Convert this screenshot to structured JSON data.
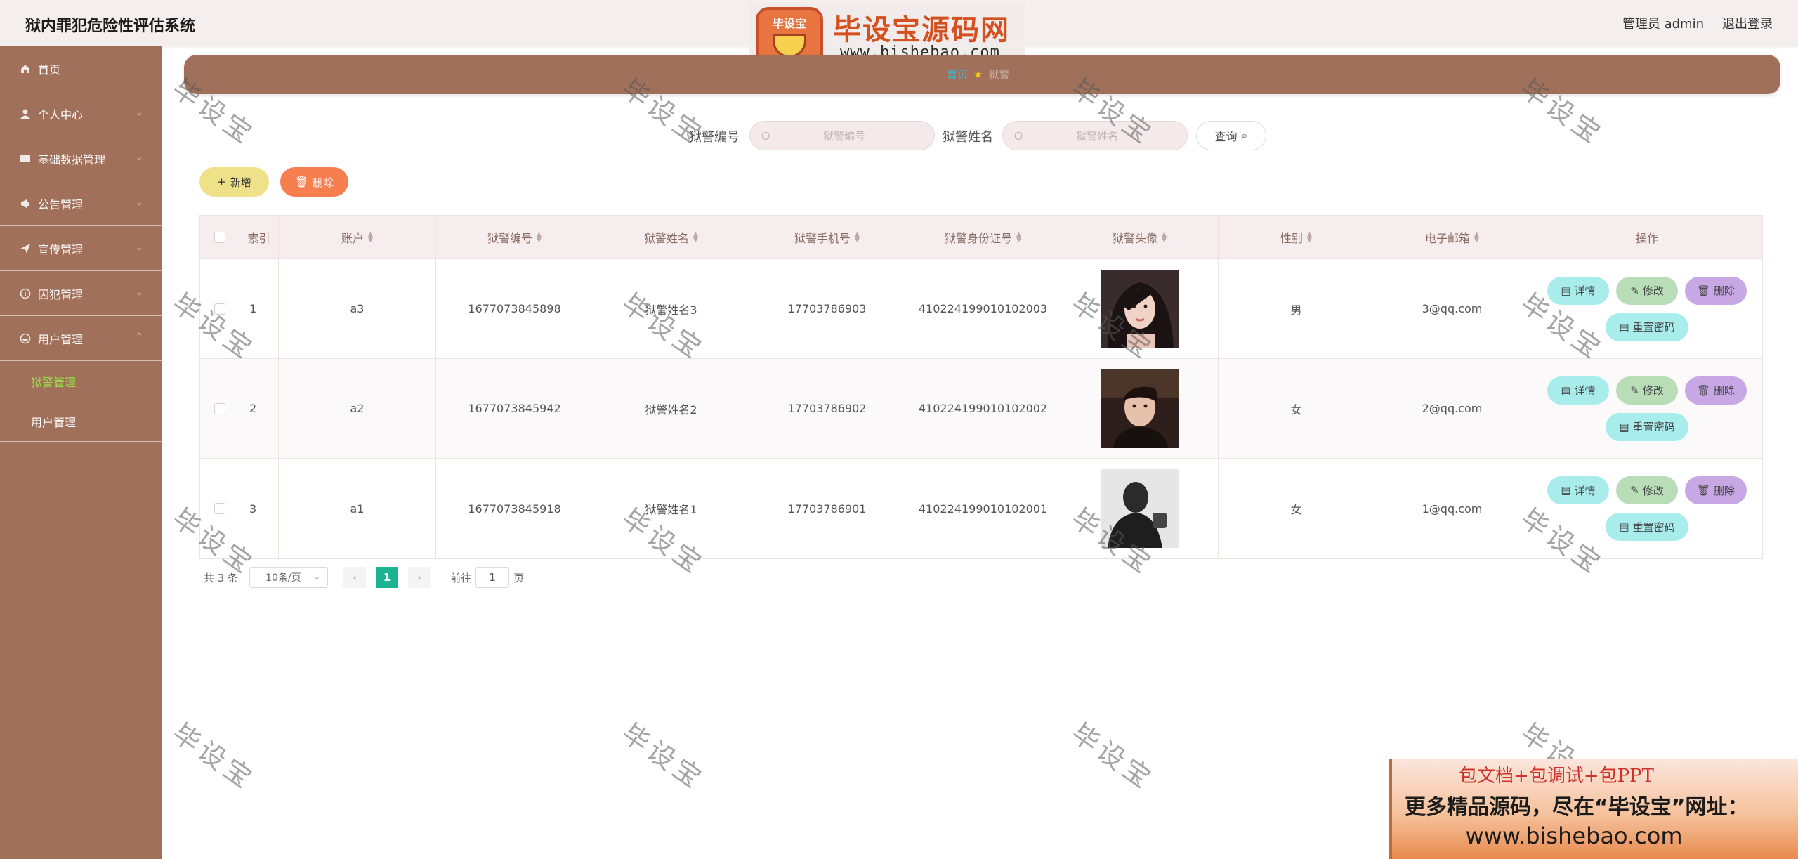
{
  "app": {
    "title": "狱内罪犯危险性评估系统",
    "admin_label": "管理员 admin",
    "logout_label": "退出登录"
  },
  "logo": {
    "badge_text": "毕设宝",
    "name": "毕设宝源码网",
    "url": "www.bishebao.com"
  },
  "sidebar": {
    "items": [
      {
        "label": "首页",
        "icon": "home-icon"
      },
      {
        "label": "个人中心",
        "icon": "user-icon"
      },
      {
        "label": "基础数据管理",
        "icon": "database-icon"
      },
      {
        "label": "公告管理",
        "icon": "notice-icon"
      },
      {
        "label": "宣传管理",
        "icon": "send-icon"
      },
      {
        "label": "囚犯管理",
        "icon": "info-icon"
      },
      {
        "label": "用户管理",
        "icon": "users-icon"
      }
    ],
    "subitems": [
      {
        "label": "狱警管理",
        "active": true
      },
      {
        "label": "用户管理",
        "active": false
      }
    ]
  },
  "breadcrumb": {
    "home": "首页",
    "current": "狱警"
  },
  "search": {
    "field1_label": "狱警编号",
    "field1_placeholder": "狱警编号",
    "field2_label": "狱警姓名",
    "field2_placeholder": "狱警姓名",
    "query_label": "查询"
  },
  "actions": {
    "add_label": "新增",
    "delete_label": "删除"
  },
  "table": {
    "headers": [
      "索引",
      "账户",
      "狱警编号",
      "狱警姓名",
      "狱警手机号",
      "狱警身份证号",
      "狱警头像",
      "性别",
      "电子邮箱",
      "操作"
    ],
    "rows": [
      {
        "index": "1",
        "account": "a3",
        "code": "1677073845898",
        "name": "狱警姓名3",
        "phone": "17703786903",
        "id_card": "410224199010102003",
        "gender": "男",
        "email": "3@qq.com",
        "avatar_style": "female-dark"
      },
      {
        "index": "2",
        "account": "a2",
        "code": "1677073845942",
        "name": "狱警姓名2",
        "phone": "17703786902",
        "id_card": "410224199010102002",
        "gender": "女",
        "email": "2@qq.com",
        "avatar_style": "male-dark"
      },
      {
        "index": "3",
        "account": "a1",
        "code": "1677073845918",
        "name": "狱警姓名1",
        "phone": "17703786901",
        "id_card": "410224199010102001",
        "gender": "女",
        "email": "1@qq.com",
        "avatar_style": "male-mono"
      }
    ],
    "op_labels": {
      "detail": "详情",
      "edit": "修改",
      "delete": "删除",
      "reset": "重置密码"
    }
  },
  "pagination": {
    "total": "共 3 条",
    "page_size": "10条/页",
    "current_page": "1",
    "goto_prefix": "前往",
    "goto_value": "1",
    "goto_suffix": "页"
  },
  "watermark": "毕设宝",
  "ad": {
    "line1": "包文档+包调试+包PPT",
    "line2": "更多精品源码，尽在“毕设宝”网址：",
    "line3": "www.bishebao.com"
  },
  "colors": {
    "sidebar": "#a0705a",
    "accent_active": "#9be04a",
    "pager_current": "#1ab394"
  }
}
